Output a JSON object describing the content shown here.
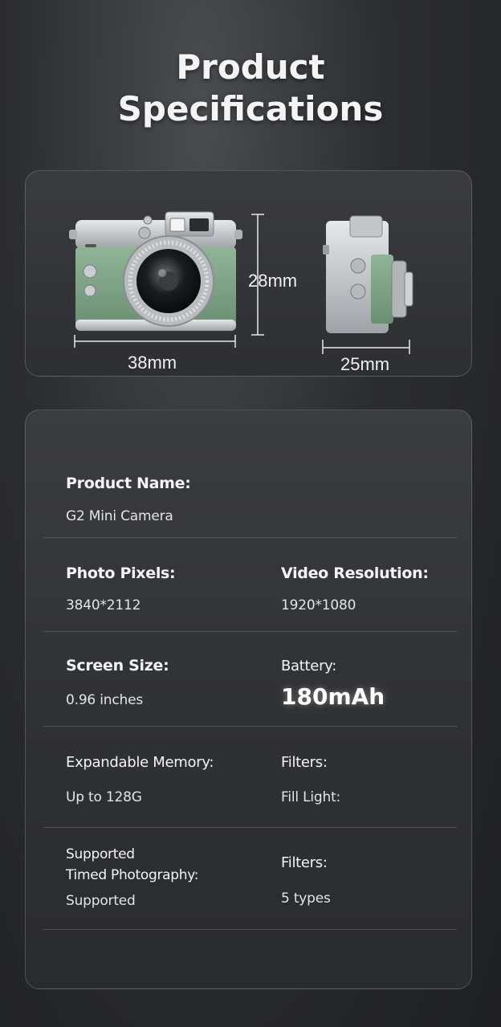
{
  "header": {
    "title_line1": "Product",
    "title_line2": "Specifications"
  },
  "dimensions": {
    "height": "28mm",
    "width": "38mm",
    "depth": "25mm"
  },
  "specs": {
    "product_name": {
      "label": "Product Name:",
      "value": "G2 Mini Camera"
    },
    "photo_pixels": {
      "label": "Photo Pixels:",
      "value": "3840*2112"
    },
    "video_resolution": {
      "label": "Video Resolution:",
      "value": "1920*1080"
    },
    "screen_size": {
      "label": "Screen Size:",
      "value": "0.96 inches"
    },
    "battery": {
      "label": "Battery:",
      "value": "180mAh"
    },
    "expandable_memory": {
      "label": "Expandable Memory:",
      "value": "Up to 128G"
    },
    "filters_1": {
      "label": "Filters:",
      "value": "Fill Light:"
    },
    "timed_photography": {
      "label_line1": "Supported",
      "label_line2": "Timed Photography:",
      "value": "Supported"
    },
    "filters_2": {
      "label": "Filters:",
      "value": "5 types"
    }
  },
  "colors": {
    "camera_body": "#7ea486",
    "camera_metal": "#c9cdd0",
    "background": "#2c2d30"
  }
}
